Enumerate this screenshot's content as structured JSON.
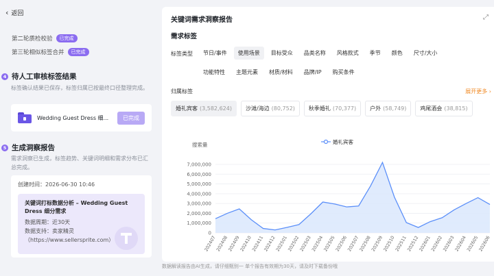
{
  "left": {
    "back_label": "返回",
    "steps": [
      {
        "label": "第二轮质检校验",
        "badge": "已完成"
      },
      {
        "label": "第三轮相似标签合并",
        "badge": "已完成"
      }
    ],
    "section4": {
      "num": "4",
      "title": "待人工审核标签结果",
      "desc": "标签确认结果已保存，标签归属已按最终口径整理完成。"
    },
    "file": {
      "name": "Wedding Guest Dress 细...",
      "status": "已完成"
    },
    "section5": {
      "num": "5",
      "title": "生成洞察报告",
      "desc": "需求洞察已生成，标签趋势、关键词明细和需求分布已汇总完成。"
    },
    "report": {
      "created": "创建时间：2026-06-30 10:46",
      "title": "关键词打标数据分析 – Wedding Guest Dress 细分需求",
      "period": "数据周期：近30天",
      "support": "数据支持：卖家精灵",
      "url": "（https://www.sellersprite.com）"
    }
  },
  "right": {
    "title": "关键词需求洞察报告",
    "subtitle": "需求标签",
    "type_label": "标签类型",
    "type_tags_row1": [
      "节日/事件",
      "使用场景",
      "目标受众",
      "品类名称",
      "风格款式",
      "季节",
      "颜色",
      "尺寸/大小"
    ],
    "type_tags_row2": [
      "功能特性",
      "主题元素",
      "材质/材料",
      "品牌/IP",
      "购买条件"
    ],
    "active_type": "使用场景",
    "belong_label": "归属标签",
    "more_label": "展开更多",
    "cat_tags": [
      {
        "name": "婚礼宾客",
        "count": "(3,582,624)"
      },
      {
        "name": "沙滩/海边",
        "count": "(80,752)"
      },
      {
        "name": "秋季婚礼",
        "count": "(70,377)"
      },
      {
        "name": "户外",
        "count": "(58,749)"
      },
      {
        "name": "鸡尾酒会",
        "count": "(38,815)"
      }
    ]
  },
  "footer": "数据解读报告由AI生成，请仔细甄别一  单个报告有效期为30天，请及时下载备份哦",
  "colors": {
    "accent": "#8b6cf0",
    "line": "#5b8ff9",
    "area": "#dbe7fd",
    "orange": "#f08a24"
  },
  "chart_data": {
    "type": "area",
    "ylabel": "搜索量",
    "legend": "婚礼宾客",
    "yticks": [
      "0",
      "1,000,000",
      "2,000,000",
      "3,000,000",
      "4,000,000",
      "5,000,000",
      "6,000,000",
      "7,000,000"
    ],
    "ylim": [
      0,
      7000000
    ],
    "x": [
      "202407",
      "202408",
      "202409",
      "202410",
      "202411",
      "202412",
      "202501",
      "202502",
      "202503",
      "202504",
      "202505",
      "202506",
      "202507",
      "202508",
      "202509",
      "202510",
      "202511",
      "202512",
      "202601",
      "202602",
      "202603",
      "202604",
      "202605",
      "202606"
    ],
    "values": [
      1450000,
      2000000,
      2450000,
      1350000,
      450000,
      300000,
      560000,
      850000,
      1950000,
      3150000,
      2950000,
      2650000,
      2750000,
      4800000,
      7200000,
      3650000,
      1050000,
      550000,
      1150000,
      1550000,
      2350000,
      3000000,
      3600000,
      2900000
    ]
  }
}
